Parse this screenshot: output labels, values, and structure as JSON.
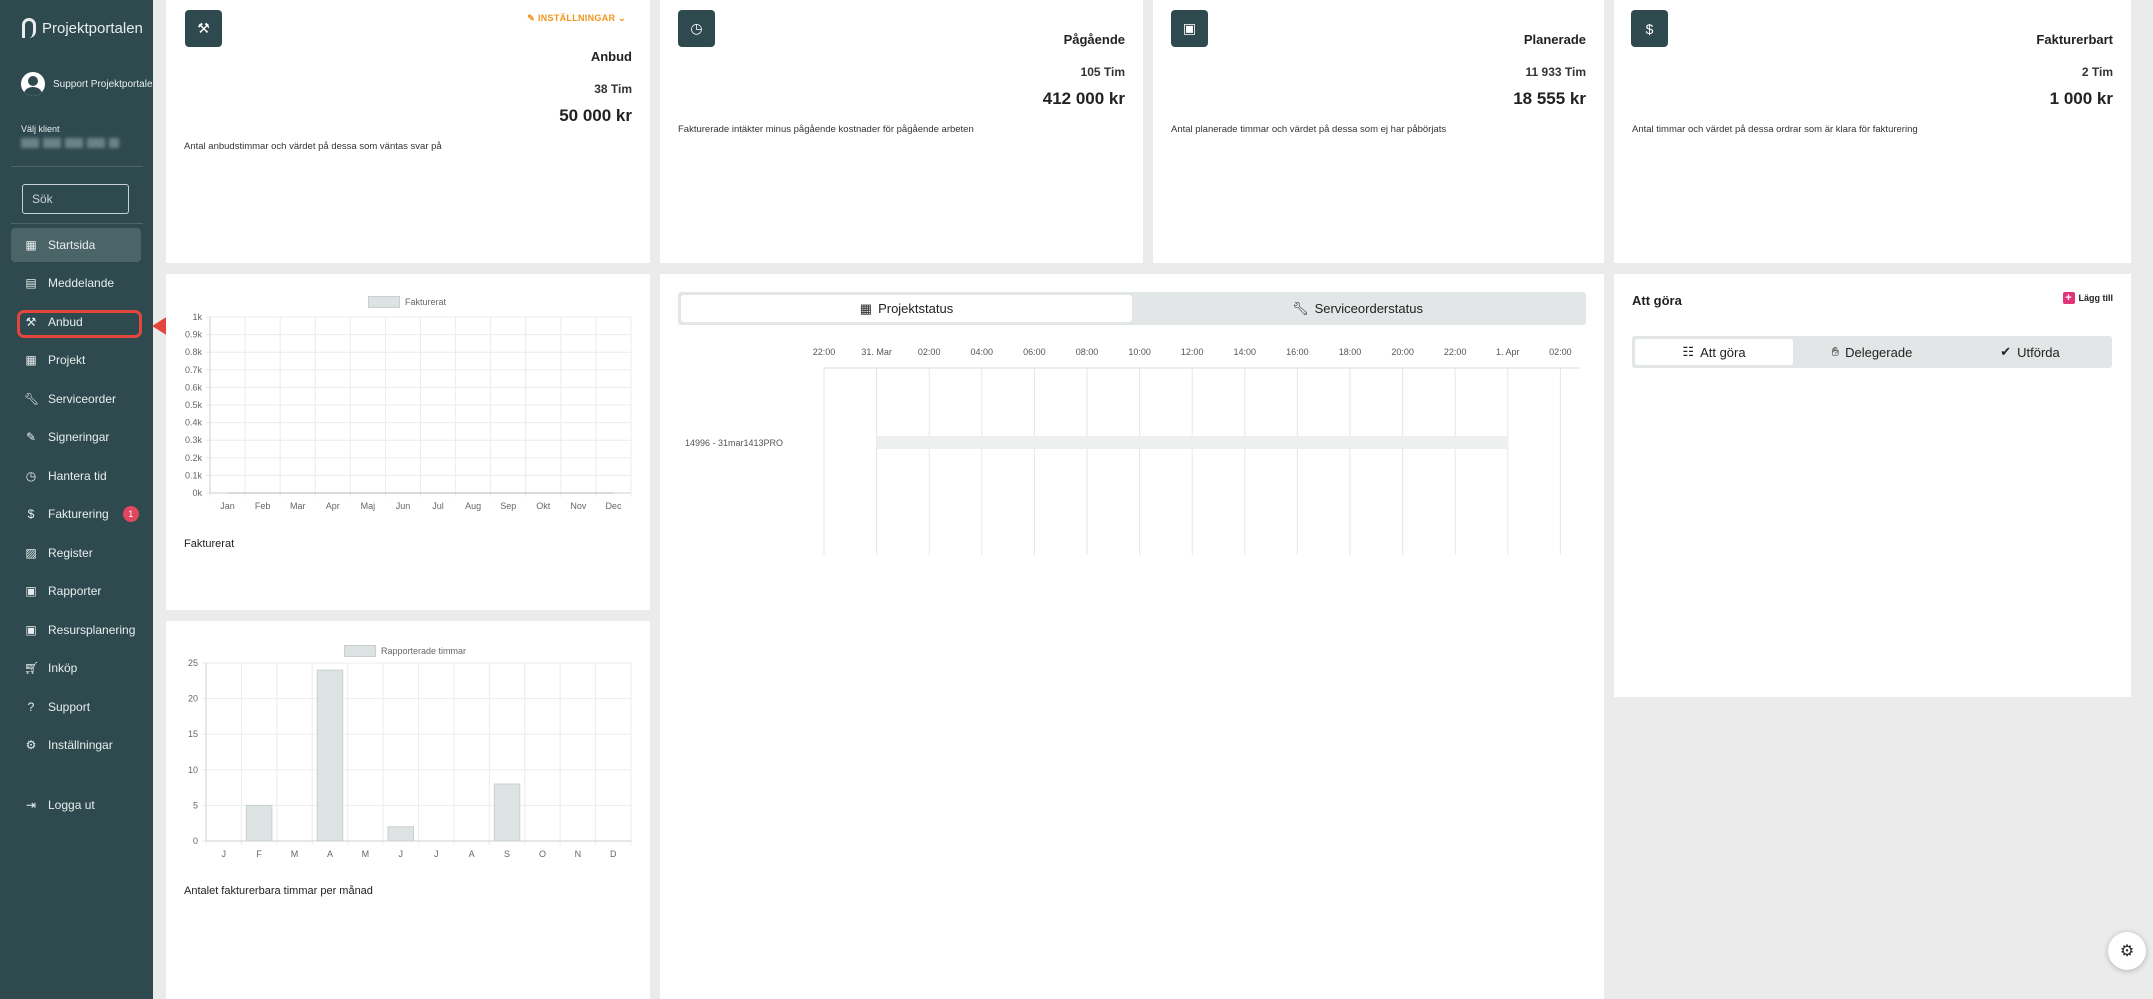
{
  "sidebar": {
    "brand": "Projektportalen",
    "user_name": "Support Projektportalen",
    "client_label": "Välj klient",
    "search_placeholder": "Sök",
    "items": [
      {
        "label": "Startsida",
        "icon": "dashboard-icon"
      },
      {
        "label": "Meddelande",
        "icon": "message-icon"
      },
      {
        "label": "Anbud",
        "icon": "gavel-icon"
      },
      {
        "label": "Projekt",
        "icon": "grid-icon"
      },
      {
        "label": "Serviceorder",
        "icon": "wrench-icon"
      },
      {
        "label": "Signeringar",
        "icon": "signature-icon"
      },
      {
        "label": "Hantera tid",
        "icon": "clock-icon"
      },
      {
        "label": "Fakturering",
        "icon": "dollar-icon",
        "badge": "1"
      },
      {
        "label": "Register",
        "icon": "register-icon"
      },
      {
        "label": "Rapporter",
        "icon": "report-icon"
      },
      {
        "label": "Resursplanering",
        "icon": "calendar-icon"
      },
      {
        "label": "Inköp",
        "icon": "cart-icon"
      },
      {
        "label": "Support",
        "icon": "help-icon"
      },
      {
        "label": "Inställningar",
        "icon": "gear-icon"
      },
      {
        "label": "Logga ut",
        "icon": "logout-icon"
      }
    ]
  },
  "stats": {
    "anbud": {
      "title": "Anbud",
      "hours": "38 Tim",
      "value": "50 000 kr",
      "desc": "Antal anbudstimmar och värdet på dessa som väntas svar på",
      "settings_label": "INSTÄLLNINGAR"
    },
    "pagaende": {
      "title": "Pågående",
      "hours": "105 Tim",
      "value": "412 000 kr",
      "desc": "Fakturerade intäkter minus pågående kostnader för pågående arbeten"
    },
    "planerade": {
      "title": "Planerade",
      "hours": "11 933 Tim",
      "value": "18 555 kr",
      "desc": "Antal planerade timmar och värdet på dessa som ej har påbörjats"
    },
    "fakturerbart": {
      "title": "Fakturerbart",
      "hours": "2 Tim",
      "value": "1 000 kr",
      "desc": "Antal timmar och värdet på dessa ordrar som är klara för fakturering"
    }
  },
  "chart_data": [
    {
      "type": "line",
      "legend": "Fakturerat",
      "caption": "Fakturerat",
      "categories": [
        "Jan",
        "Feb",
        "Mar",
        "Apr",
        "Maj",
        "Jun",
        "Jul",
        "Aug",
        "Sep",
        "Okt",
        "Nov",
        "Dec"
      ],
      "series": [
        {
          "name": "Fakturerat",
          "values": [
            0,
            0,
            0,
            0,
            0,
            0,
            0,
            0,
            0,
            0,
            0,
            0
          ]
        }
      ],
      "yticks": [
        "0k",
        "0.1k",
        "0.2k",
        "0.3k",
        "0.4k",
        "0.5k",
        "0.6k",
        "0.7k",
        "0.8k",
        "0.9k",
        "1k"
      ],
      "ylim": [
        0,
        1000
      ],
      "legend_position": "top",
      "grid": true
    },
    {
      "type": "bar",
      "legend": "Rapporterade timmar",
      "caption": "Antalet fakturerbara timmar per månad",
      "categories": [
        "J",
        "F",
        "M",
        "A",
        "M",
        "J",
        "J",
        "A",
        "S",
        "O",
        "N",
        "D"
      ],
      "series": [
        {
          "name": "Rapporterade timmar",
          "values": [
            0,
            5,
            0,
            24,
            0,
            2,
            0,
            0,
            8,
            0,
            0,
            0
          ]
        }
      ],
      "yticks": [
        "0",
        "5",
        "10",
        "15",
        "20",
        "25"
      ],
      "ylim": [
        0,
        25
      ],
      "legend_position": "top",
      "grid": true
    }
  ],
  "gantt": {
    "tabs": [
      {
        "label": "Projektstatus",
        "icon": "grid-icon"
      },
      {
        "label": "Serviceorderstatus",
        "icon": "wrench-icon"
      }
    ],
    "time_labels": [
      "22:00",
      "31. Mar",
      "02:00",
      "04:00",
      "06:00",
      "08:00",
      "10:00",
      "12:00",
      "14:00",
      "16:00",
      "18:00",
      "20:00",
      "22:00",
      "1. Apr",
      "02:00"
    ],
    "row_label": "14996 - 31mar1413PRO"
  },
  "todo": {
    "title": "Att göra",
    "add_label": "Lägg till",
    "tabs": [
      {
        "label": "Att göra",
        "icon": "checklist-icon"
      },
      {
        "label": "Delegerade",
        "icon": "hand-icon"
      },
      {
        "label": "Utförda",
        "icon": "check-circle-icon"
      }
    ]
  },
  "colors": {
    "sidebar": "#2f4a4f",
    "accent_orange": "#f0961e",
    "badge": "#e0475f",
    "highlight": "#e4463d",
    "bar_fill": "#dde3e3"
  }
}
